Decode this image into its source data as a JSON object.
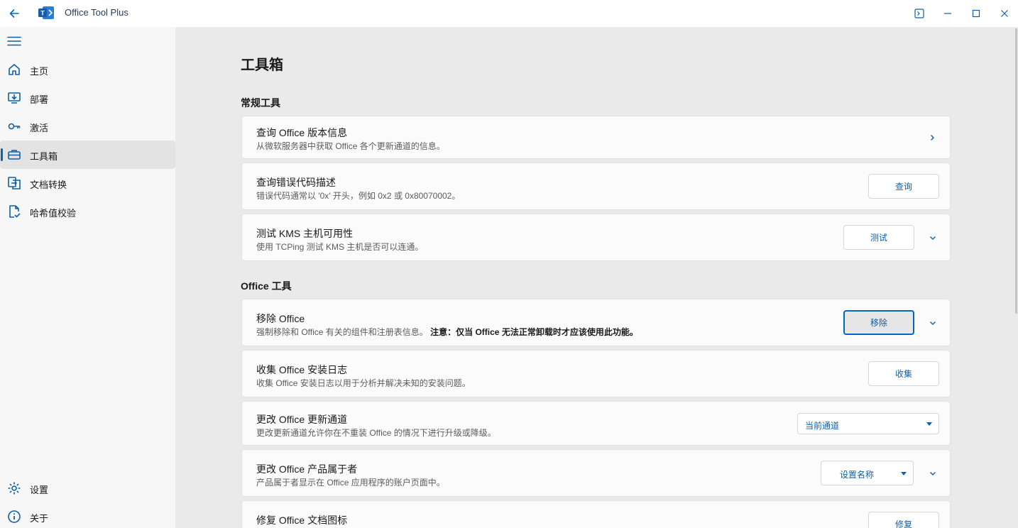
{
  "window": {
    "title": "Office Tool Plus",
    "controls": [
      "terminal-icon",
      "minimize-icon",
      "maximize-icon",
      "close-icon"
    ]
  },
  "sidebar": {
    "items": [
      {
        "label": "主页",
        "icon": "home-icon"
      },
      {
        "label": "部署",
        "icon": "deploy-icon"
      },
      {
        "label": "激活",
        "icon": "key-icon"
      },
      {
        "label": "工具箱",
        "icon": "toolbox-icon",
        "active": true
      },
      {
        "label": "文档转换",
        "icon": "convert-icon"
      },
      {
        "label": "哈希值校验",
        "icon": "hash-check-icon"
      }
    ],
    "bottom_items": [
      {
        "label": "设置",
        "icon": "gear-icon"
      },
      {
        "label": "关于",
        "icon": "info-icon"
      }
    ]
  },
  "main": {
    "title": "工具箱",
    "sections": [
      {
        "title": "常规工具"
      },
      {
        "title": "Office 工具"
      }
    ],
    "cards": [
      {
        "title": "查询 Office 版本信息",
        "desc": "从微软服务器中获取 Office 各个更新通道的信息。"
      },
      {
        "title": "查询错误代码描述",
        "desc": "错误代码通常以 '0x' 开头，例如 0x2 或 0x80070002。",
        "button": "查询"
      },
      {
        "title": "测试 KMS 主机可用性",
        "desc": "使用 TCPing 测试 KMS 主机是否可以连通。",
        "button": "测试"
      },
      {
        "title": "移除 Office",
        "desc": "强制移除和 Office 有关的组件和注册表信息。",
        "desc_bold": "注意：仅当 Office 无法正常卸载时才应该使用此功能。",
        "button": "移除"
      },
      {
        "title": "收集 Office 安装日志",
        "desc": "收集 Office 安装日志以用于分析并解决未知的安装问题。",
        "button": "收集"
      },
      {
        "title": "更改 Office 更新通道",
        "desc": "更改更新通道允许你在不重装 Office 的情况下进行升级或降级。",
        "select": "当前通道"
      },
      {
        "title": "更改 Office 产品属于者",
        "desc": "产品属于者显示在 Office 应用程序的账户页面中。",
        "select": "设置名称"
      },
      {
        "title": "修复 Office 文档图标",
        "button": "修复"
      }
    ]
  },
  "colors": {
    "accent": "#0067c0",
    "link_text": "#0f5fa8",
    "content_bg": "#eaeaea",
    "sidebar_bg": "#f7f7f7"
  }
}
